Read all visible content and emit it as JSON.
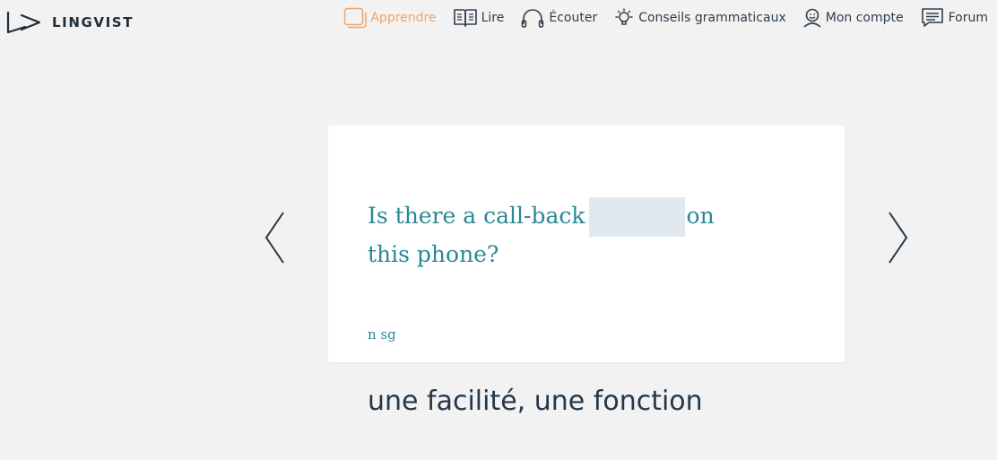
{
  "brand": {
    "name": "LINGVIST"
  },
  "nav": {
    "items": [
      {
        "label": "Apprendre",
        "icon": "cards-icon",
        "active": true
      },
      {
        "label": "Lire",
        "icon": "book-icon"
      },
      {
        "label": "Écouter",
        "icon": "headphones-icon"
      },
      {
        "label": "Conseils grammaticaux",
        "icon": "lightbulb-icon"
      },
      {
        "label": "Mon compte",
        "icon": "user-icon"
      },
      {
        "label": "Forum",
        "icon": "forum-icon"
      }
    ]
  },
  "card": {
    "sentence_before": "Is there a call-back",
    "sentence_after": "on this phone?",
    "blank_answer": "",
    "grammar": "n sg"
  },
  "translation": "une facilité, une fonction",
  "colors": {
    "accent": "#f2a469",
    "teal": "#2b8895",
    "dark": "#25384a",
    "background": "#f2f2f2",
    "blank": "#dfe9ef"
  }
}
